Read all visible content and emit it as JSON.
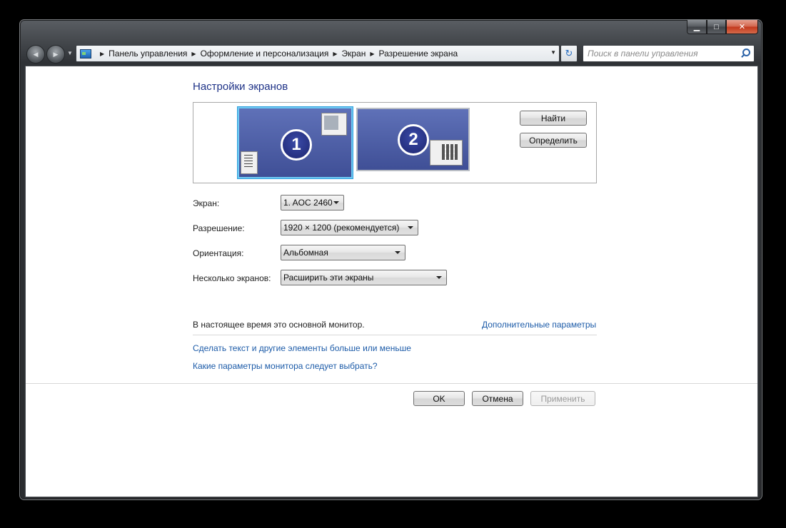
{
  "window": {
    "caption_buttons": {
      "minimize": "▁",
      "maximize": "□",
      "close": "✕"
    }
  },
  "nav": {
    "back_icon": "◀",
    "forward_icon": "▶",
    "recent_icon": "▼"
  },
  "address": {
    "crumbs": [
      "Панель управления",
      "Оформление и персонализация",
      "Экран",
      "Разрешение экрана"
    ],
    "dropdown_icon": "▼",
    "refresh_icon": "↻"
  },
  "search": {
    "placeholder": "Поиск в панели управления"
  },
  "main": {
    "title": "Настройки экранов",
    "monitors": [
      {
        "number": "1",
        "selected": true
      },
      {
        "number": "2",
        "selected": false
      }
    ],
    "detect_label": "Найти",
    "identify_label": "Определить",
    "fields": {
      "display": {
        "label": "Экран:",
        "value": "1. AOC 2460"
      },
      "resolution": {
        "label": "Разрешение:",
        "value": "1920 × 1200 (рекомендуется)"
      },
      "orientation": {
        "label": "Ориентация:",
        "value": "Альбомная"
      },
      "multiple": {
        "label": "Несколько экранов:",
        "value": "Расширить эти экраны"
      }
    },
    "status": "В настоящее время это основной монитор.",
    "advanced_link": "Дополнительные параметры",
    "links": {
      "text_size": "Сделать текст и другие элементы больше или меньше",
      "which_settings": "Какие параметры монитора следует выбрать?"
    }
  },
  "footer": {
    "ok_label": "OK",
    "cancel_label": "Отмена",
    "apply_label": "Применить"
  },
  "colors": {
    "title_blue": "#1e3287",
    "link_blue": "#1c5ba8",
    "monitor_blue": "#4f60a8",
    "selection_border": "#6fc9f3"
  }
}
